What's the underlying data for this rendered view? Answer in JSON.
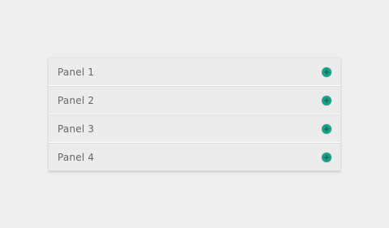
{
  "accordion": {
    "panels": [
      {
        "label": "Panel 1",
        "icon": "plus-circle-icon"
      },
      {
        "label": "Panel 2",
        "icon": "plus-circle-icon"
      },
      {
        "label": "Panel 3",
        "icon": "plus-circle-icon"
      },
      {
        "label": "Panel 4",
        "icon": "plus-circle-icon"
      }
    ],
    "accent_color": "#1aa086"
  }
}
